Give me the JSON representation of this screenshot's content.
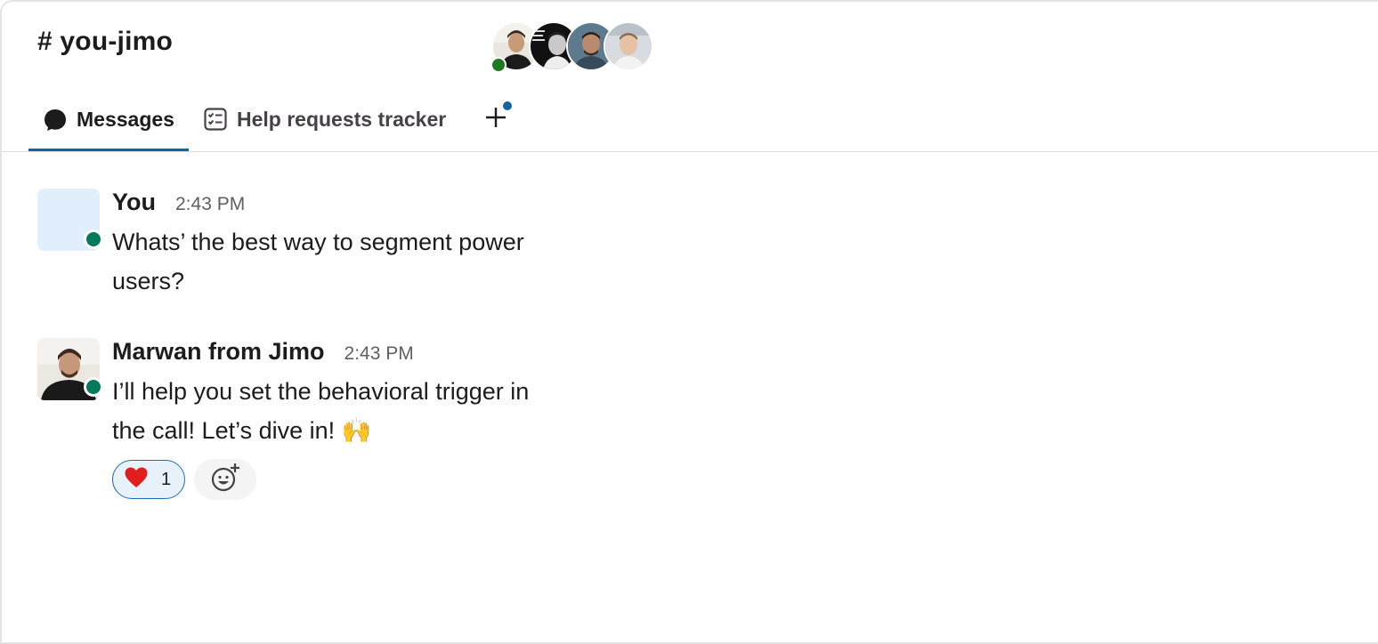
{
  "channel": {
    "title": "# you-jimo"
  },
  "members": [
    {
      "name": "marwan-avatar",
      "online": true
    },
    {
      "name": "member-2-avatar",
      "online": false
    },
    {
      "name": "member-3-avatar",
      "online": false
    },
    {
      "name": "member-4-avatar",
      "online": false
    }
  ],
  "tabs": [
    {
      "label": "Messages",
      "icon": "message-bubble-icon",
      "active": true
    },
    {
      "label": "Help requests tracker",
      "icon": "checklist-icon",
      "active": false
    }
  ],
  "add_tab": {
    "icon": "plus-icon",
    "has_notification": true
  },
  "messages": [
    {
      "author": "You",
      "time": "2:43 PM",
      "lines": [
        "Whats’ the best way to segment power",
        "users?"
      ],
      "online": true
    },
    {
      "author": "Marwan from Jimo",
      "time": "2:43 PM",
      "lines": [
        "I’ll help you set the behavioral trigger in",
        "the call! Let’s dive in! 🙌"
      ],
      "online": true,
      "reactions": [
        {
          "emoji": "heart-icon",
          "count": "1",
          "reacted_by_you": true
        }
      ]
    }
  ],
  "colors": {
    "accent": "#1264a3",
    "presence": "#007a5a",
    "reaction_bg": "#e8f2fb",
    "heart": "#e01e1e"
  }
}
